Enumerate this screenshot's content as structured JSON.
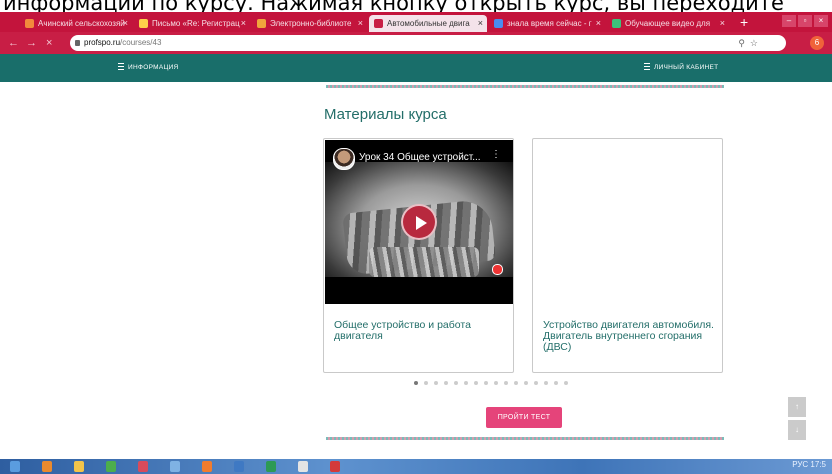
{
  "caption": "информации по курсу. Нажимая кнопку открыть курс, вы переходите",
  "browser": {
    "tabs": [
      {
        "label": "Ачинский сельскохозяй",
        "favicon": "#f28a3c"
      },
      {
        "label": "Письмо «Re: Регистрац",
        "favicon": "#ffd04a"
      },
      {
        "label": "Электронно-библиоте",
        "favicon": "#f0a53c"
      },
      {
        "label": "Автомобильные двига",
        "favicon": "#c81e45",
        "active": true
      },
      {
        "label": "знала время сейчас - г",
        "favicon": "#4a8bf0"
      },
      {
        "label": "Обучающее видео для",
        "favicon": "#3dc27a"
      }
    ],
    "new_tab": "+",
    "window_buttons": [
      "–",
      "▫",
      "×"
    ],
    "address": {
      "host": "profspo.ru",
      "path": "/courses/43"
    },
    "extension_badge": "6"
  },
  "site_nav": {
    "left_label": "ИНФОРМАЦИЯ",
    "right_label": "ЛИЧНЫЙ КАБИНЕТ"
  },
  "section_title": "Материалы курса",
  "cards": [
    {
      "video_title": "Урок 34 Общее устройст...",
      "caption": "Общее устройство и работа двигателя"
    },
    {
      "caption": "Устройство двигателя автомобиля. Двигатель внутреннего сгорания (ДВС)"
    }
  ],
  "pager": {
    "total": 16,
    "active_index": 0
  },
  "test_button": "ПРОЙТИ ТЕСТ",
  "scroll_up": "↑",
  "scroll_down": "↓",
  "taskbar": {
    "icons": [
      "#5a9cdf",
      "#e98a2e",
      "#f2c44a",
      "#4cae4c",
      "#d84b5c",
      "#7fb2e4",
      "#f07c2e",
      "#3f79c3",
      "#2d9a54",
      "#e4e4e4",
      "#d33a3a"
    ],
    "tray": "РУС  17:5"
  }
}
